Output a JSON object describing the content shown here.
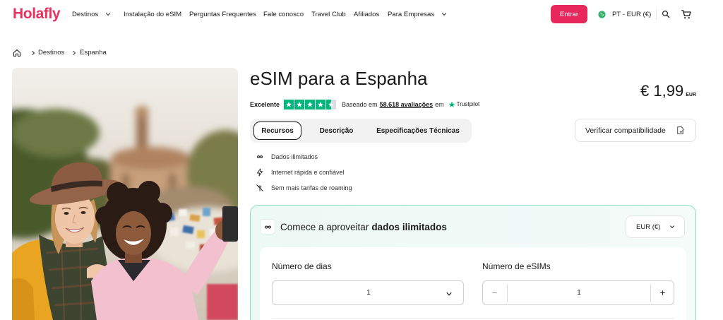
{
  "brand": {
    "logo_text": "Holafly",
    "color": "#e6335f"
  },
  "header": {
    "nav": [
      {
        "label": "Destinos",
        "dropdown": true
      },
      {
        "label": "Instalação do eSIM",
        "dropdown": false
      },
      {
        "label": "Perguntas Frequentes",
        "dropdown": false
      },
      {
        "label": "Fale conosco",
        "dropdown": false
      },
      {
        "label": "Travel Club",
        "dropdown": false
      },
      {
        "label": "Afiliados",
        "dropdown": false
      },
      {
        "label": "Para Empresas",
        "dropdown": true
      }
    ],
    "login_label": "Entrar",
    "login_color": "#e6285d",
    "locale_label": "PT - EUR (€)",
    "icons": [
      "globe-icon",
      "search-icon",
      "cart-icon"
    ]
  },
  "breadcrumb": {
    "home_icon": "home-icon",
    "items": [
      "Destinos",
      "Espanha"
    ]
  },
  "product": {
    "title": "eSIM para a Espanha",
    "price": "€ 1,99",
    "price_currency": "EUR",
    "rating": {
      "label": "Excelente",
      "stars": 4.5,
      "based_on": "Baseado em",
      "reviews": "58.618 avaliações",
      "on": "em",
      "source": "Trustpilot",
      "star_color": "#00b67a"
    },
    "tabs": [
      {
        "label": "Recursos",
        "active": true
      },
      {
        "label": "Descrição",
        "active": false
      },
      {
        "label": "Especificações Técnicas",
        "active": false
      }
    ],
    "compatibility_button": "Verificar compatibilidade",
    "features": [
      {
        "icon": "infinity-icon",
        "label": "Dados ilimitados"
      },
      {
        "icon": "lightning-icon",
        "label": "Internet rápida e confiável"
      },
      {
        "icon": "no-roaming-icon",
        "label": "Sem mais tarifas de roaming"
      }
    ]
  },
  "plan": {
    "icon": "infinity-icon",
    "heading_prefix": "Comece a aproveitar",
    "heading_bold": "dados ilimitados",
    "currency_select": "EUR (€)",
    "days_label": "Número de dias",
    "days_value": "1",
    "esims_label": "Número de eSIMs",
    "esims_value": "1",
    "accent_color": "#8fdcc6"
  }
}
